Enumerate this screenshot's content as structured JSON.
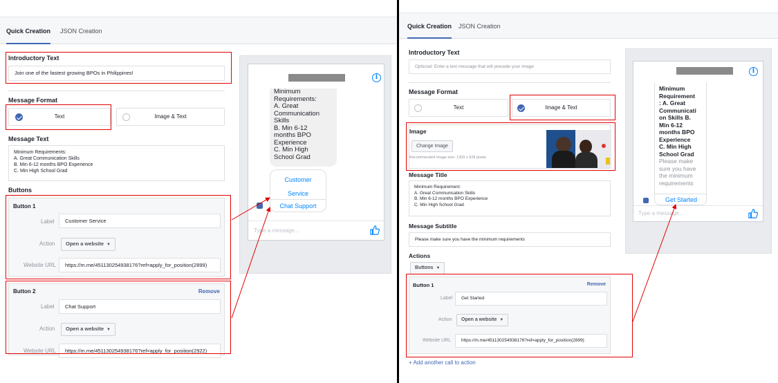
{
  "left": {
    "tabs": [
      "Quick Creation",
      "JSON Creation"
    ],
    "intro": {
      "label": "Introductory Text",
      "value": "Join one of the fastest growing BPOs in Philippines!"
    },
    "format": {
      "label": "Message Format",
      "text_option": "Text",
      "image_text_option": "Image & Text",
      "selected": "Text"
    },
    "message_text": {
      "label": "Message Text",
      "lines": [
        "Minimum Requirements:",
        "A. Great Communication Skills",
        "B. Min 6-12 months BPO Experience",
        "C. Min High School Grad"
      ]
    },
    "buttons_label": "Buttons",
    "button1": {
      "title": "Button 1",
      "label_caption": "Label",
      "label_value": "Customer Service",
      "action_caption": "Action",
      "action_value": "Open a website",
      "url_caption": "Website URL",
      "url_value": "https://m.me/451130254938176?ref=apply_for_position(2899)"
    },
    "button2": {
      "title": "Button 2",
      "remove": "Remove",
      "label_caption": "Label",
      "label_value": "Chat Support",
      "action_caption": "Action",
      "action_value": "Open a website",
      "url_caption": "Website URL",
      "url_value": "https://m.me/451130254938176?ref=apply_for_position(2922)"
    },
    "preview": {
      "bubble_lines": [
        "Minimum",
        "Requirements:",
        "A. Great",
        "Communication",
        "Skills",
        "B. Min 6-12",
        "months BPO",
        "Experience",
        "C. Min High",
        "School Grad"
      ],
      "button1_lines": [
        "Customer",
        "Service"
      ],
      "button2": "Chat Support",
      "compose_placeholder": "Type a message...",
      "info": "i"
    }
  },
  "right": {
    "tabs": [
      "Quick Creation",
      "JSON Creation"
    ],
    "intro": {
      "label": "Introductory Text",
      "placeholder": "Optional: Enter a text message that will precede your image"
    },
    "format": {
      "label": "Message Format",
      "text_option": "Text",
      "image_text_option": "Image & Text",
      "selected": "Image & Text"
    },
    "image": {
      "label": "Image",
      "change_button": "Change Image",
      "recommended": "Recommended image size: 1200 x 628 pixels"
    },
    "title": {
      "label": "Message Title",
      "lines": [
        "Minimum Requirement:",
        "A. Great Communication Skills",
        "B. Min 6-12 months BPO Experience",
        "C. Min High School Grad"
      ]
    },
    "subtitle": {
      "label": "Message Subtitle",
      "value": "Please make sure you have the minimum requirements"
    },
    "actions": {
      "label": "Actions",
      "dropdown": "Buttons"
    },
    "button1": {
      "title": "Button 1",
      "remove": "Remove",
      "label_caption": "Label",
      "label_value": "Get Started",
      "action_caption": "Action",
      "action_value": "Open a website",
      "url_caption": "Website URL",
      "url_value": "https://m.me/451130254938176?ref=apply_for_position(2899)"
    },
    "add_cta": "+ Add another call to action",
    "preview": {
      "bold_lines": [
        "Minimum",
        "Requirement",
        ": A. Great",
        "Communicati",
        "on Skills B.",
        "Min 6-12",
        "months BPO",
        "Experience",
        "C. Min High",
        "School Grad"
      ],
      "sub_lines": [
        "Please make",
        "sure you have",
        "the minimum",
        "requirements"
      ],
      "cta": "Get Started",
      "compose_placeholder": "Type a message...",
      "info": "i"
    }
  },
  "colors": {
    "highlight": "#e00000",
    "brand": "#4267b2",
    "messenger": "#0084ff"
  }
}
